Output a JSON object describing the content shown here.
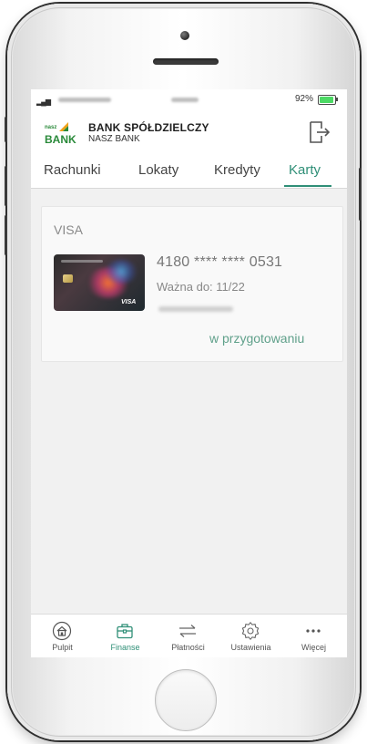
{
  "status_bar": {
    "battery_percent_label": "92%",
    "battery_level": 0.92
  },
  "header": {
    "logo_small": "nasz",
    "logo_big": "BANK",
    "bank_name": "BANK SPÓŁDZIELCZY",
    "bank_subtitle": "NASZ BANK",
    "logout_icon": "logout-icon"
  },
  "tabs": {
    "active": "Karty",
    "items": [
      {
        "label": "Rachunki"
      },
      {
        "label": "Lokaty"
      },
      {
        "label": "Kredyty"
      },
      {
        "label": "Karty"
      }
    ]
  },
  "cards": {
    "type": "VISA",
    "items": [
      {
        "number": "4180 **** **** 0531",
        "valid_until": "Ważna do: 11/22",
        "status": "w przygotowaniu",
        "thumbnail_brand": "VISA"
      }
    ]
  },
  "bottom_nav": {
    "active": "Finanse",
    "items": [
      {
        "label": "Pulpit",
        "icon": "home-icon"
      },
      {
        "label": "Finanse",
        "icon": "briefcase-icon"
      },
      {
        "label": "Płatności",
        "icon": "transfer-arrows-icon"
      },
      {
        "label": "Ustawienia",
        "icon": "gear-icon"
      },
      {
        "label": "Więcej",
        "icon": "more-dots-icon"
      }
    ]
  },
  "colors": {
    "accent": "#2f8f77",
    "brand_green": "#2a8a3a",
    "status_text": "#5fa08a"
  }
}
